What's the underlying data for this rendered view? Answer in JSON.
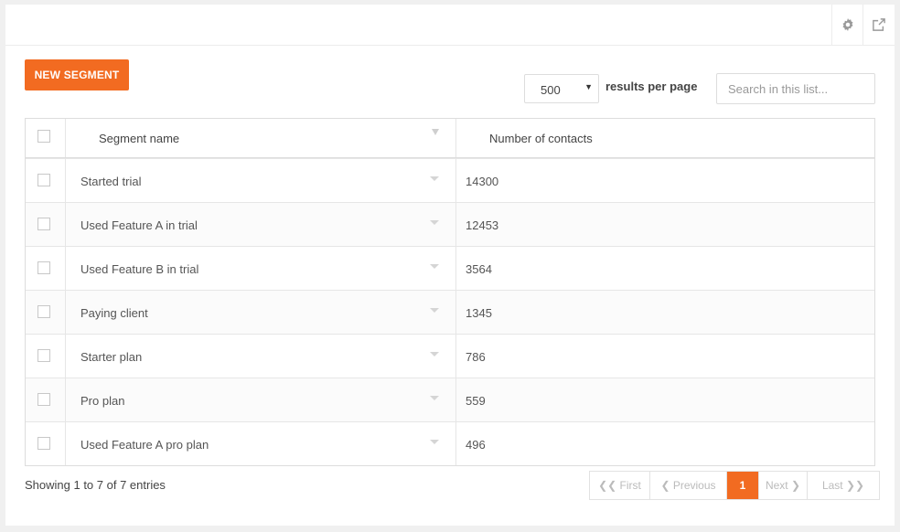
{
  "toolbar": {
    "settings_icon": "gear-icon",
    "export_icon": "export-icon"
  },
  "actions": {
    "new_segment_label": "NEW SEGMENT"
  },
  "list_controls": {
    "per_page_value": "500",
    "per_page_label": "results per page",
    "search_placeholder": "Search in this list..."
  },
  "table": {
    "columns": {
      "name": "Segment name",
      "contacts": "Number of contacts"
    },
    "rows": [
      {
        "name": "Started trial",
        "contacts": "14300"
      },
      {
        "name": "Used Feature A in trial",
        "contacts": "12453"
      },
      {
        "name": "Used Feature B in trial",
        "contacts": "3564"
      },
      {
        "name": "Paying client",
        "contacts": "1345"
      },
      {
        "name": "Starter plan",
        "contacts": "786"
      },
      {
        "name": "Pro plan",
        "contacts": "559"
      },
      {
        "name": "Used Feature A pro plan",
        "contacts": "496"
      }
    ]
  },
  "footer": {
    "info": "Showing 1 to 7 of 7 entries"
  },
  "pagination": {
    "first": "❮❮ First",
    "previous": "❮ Previous",
    "current": "1",
    "next": "Next ❯",
    "last": "Last ❯❯"
  },
  "colors": {
    "accent": "#f26b21"
  }
}
